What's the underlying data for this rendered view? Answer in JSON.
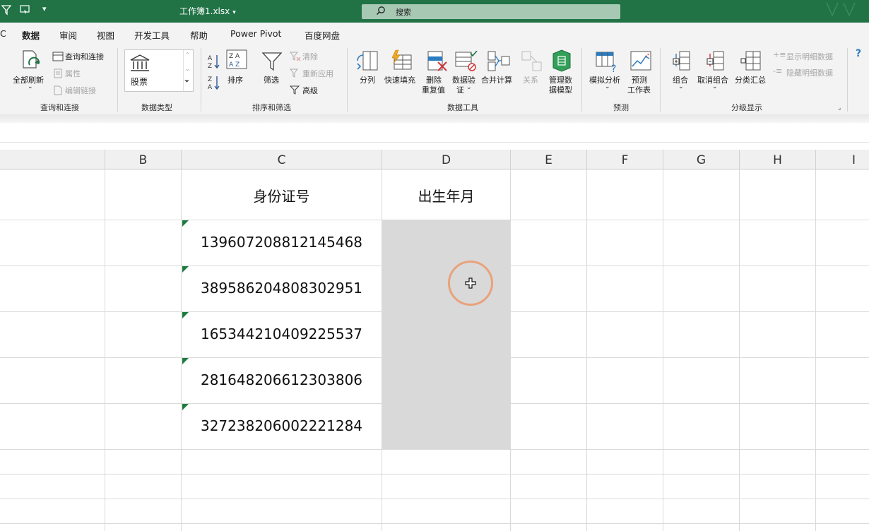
{
  "titlebar": {
    "title": "工作簿1.xlsx",
    "title_caret": "▾",
    "search_placeholder": "搜索"
  },
  "tabs": [
    "数据",
    "审阅",
    "视图",
    "开发工具",
    "帮助",
    "Power Pivot",
    "百度网盘"
  ],
  "tab_partial": "C",
  "ribbon": {
    "groups": {
      "query": "查询和连接",
      "datatype": "数据类型",
      "sort_filter": "排序和筛选",
      "datatools": "数据工具",
      "forecast": "预测",
      "outline": "分级显示"
    },
    "query": {
      "refresh_all": "全部刷新",
      "query_connect": "查询和连接",
      "properties": "属性",
      "edit_links": "编辑链接"
    },
    "datatype": {
      "stocks": "股票"
    },
    "sort_filter": {
      "sort": "排序",
      "filter": "筛选",
      "clear": "清除",
      "reapply": "重新应用",
      "advanced": "高级"
    },
    "datatools": {
      "text_to_columns": "分列",
      "flash_fill": "快速填充",
      "remove_dup_1": "删除",
      "remove_dup_2": "重复值",
      "validation_1": "数据验",
      "validation_2": "证",
      "consolidate": "合并计算",
      "relationships": "关系",
      "manage_model_1": "管理数",
      "manage_model_2": "据模型"
    },
    "forecast": {
      "whatif": "模拟分析",
      "sheet_1": "预测",
      "sheet_2": "工作表"
    },
    "outline": {
      "group": "组合",
      "ungroup": "取消组合",
      "subtotal": "分类汇总",
      "show_detail": "显示明细数据",
      "hide_detail": "隐藏明细数据"
    },
    "help_icon": "?"
  },
  "columns": [
    "B",
    "C",
    "D",
    "E",
    "F",
    "G",
    "H",
    "I"
  ],
  "sheet": {
    "header_c": "身份证号",
    "header_d": "出生年月",
    "ids": [
      "139607208812145468",
      "389586204808302951",
      "165344210409225537",
      "281648206612303806",
      "327238206002221284"
    ]
  },
  "colors": {
    "accent": "#217346",
    "selection": "#d9d9d9",
    "cursor_ring": "#e9a27a"
  }
}
